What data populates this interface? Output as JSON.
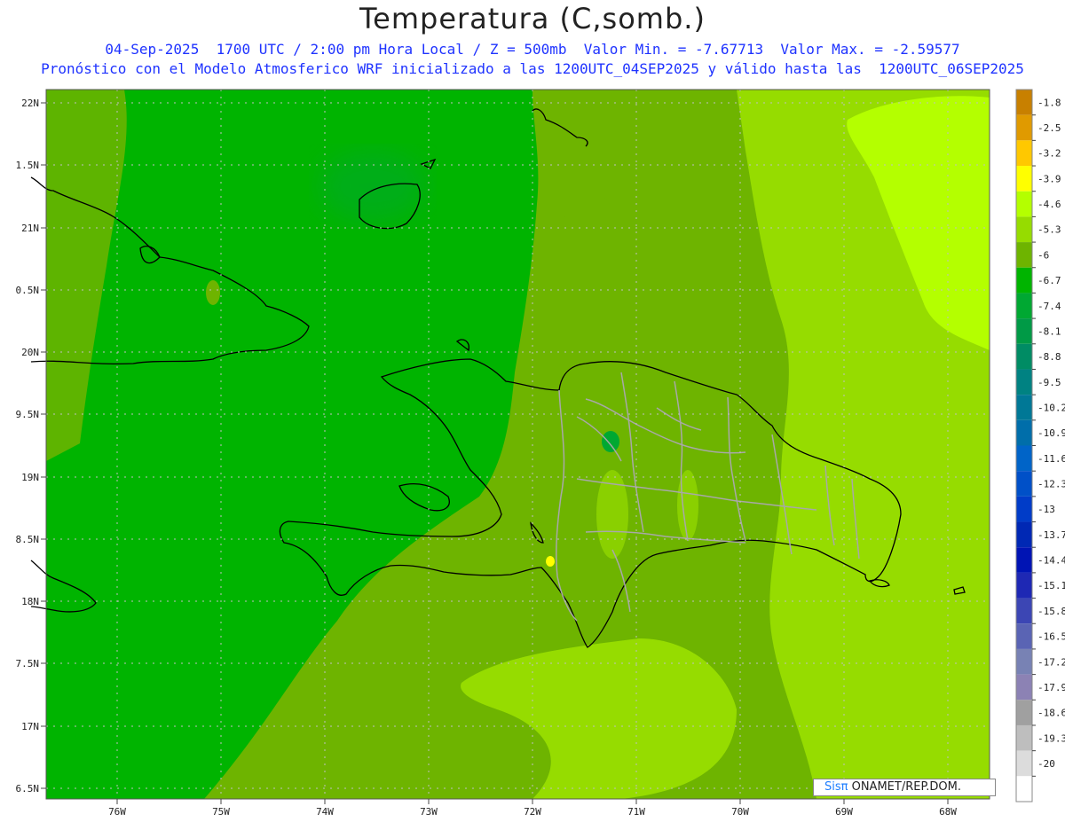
{
  "header": {
    "title": "Temperatura (C,somb.)",
    "line1": "04-Sep-2025  1700 UTC / 2:00 pm Hora Local / Z = 500mb  Valor Min. = -7.67713  Valor Max. = -2.59577",
    "line2": "Pronóstico con el Modelo Atmosferico WRF inicializado a las 1200UTC_04SEP2025 y válido hasta las  1200UTC_06SEP2025"
  },
  "axes": {
    "lat_labels": [
      "22N",
      "1.5N",
      "21N",
      "0.5N",
      "20N",
      "9.5N",
      "19N",
      "8.5N",
      "18N",
      "7.5N",
      "17N",
      "6.5N"
    ],
    "lon_labels": [
      "76W",
      "75W",
      "74W",
      "73W",
      "72W",
      "71W",
      "70W",
      "69W",
      "68W"
    ]
  },
  "legend": {
    "labels": [
      "-1.8",
      "-2.5",
      "-3.2",
      "-3.9",
      "-4.6",
      "-5.3",
      "-6",
      "-6.7",
      "-7.4",
      "-8.1",
      "-8.8",
      "-9.5",
      "-10.2",
      "-10.9",
      "-11.6",
      "-12.3",
      "-13",
      "-13.7",
      "-14.4",
      "-15.1",
      "-15.8",
      "-16.5",
      "-17.2",
      "-17.9",
      "-18.6",
      "-19.3",
      "-20"
    ],
    "colors": [
      "#c88000",
      "#e09a00",
      "#ffc800",
      "#ffff00",
      "#b4ff00",
      "#96dc00",
      "#6eb400",
      "#00b400",
      "#00a832",
      "#009a46",
      "#008c64",
      "#008282",
      "#007896",
      "#006eaa",
      "#0064c8",
      "#0050c8",
      "#003cc8",
      "#0028b4",
      "#0014b4",
      "#1e28b4",
      "#3c46b4",
      "#5a64b4",
      "#7882b4",
      "#8c82b4",
      "#a0a0a0",
      "#bebebe",
      "#dcdcdc",
      "#ffffff"
    ]
  },
  "credit": {
    "brand": "Sisπ",
    "text": " ONAMET/REP.DOM."
  }
}
